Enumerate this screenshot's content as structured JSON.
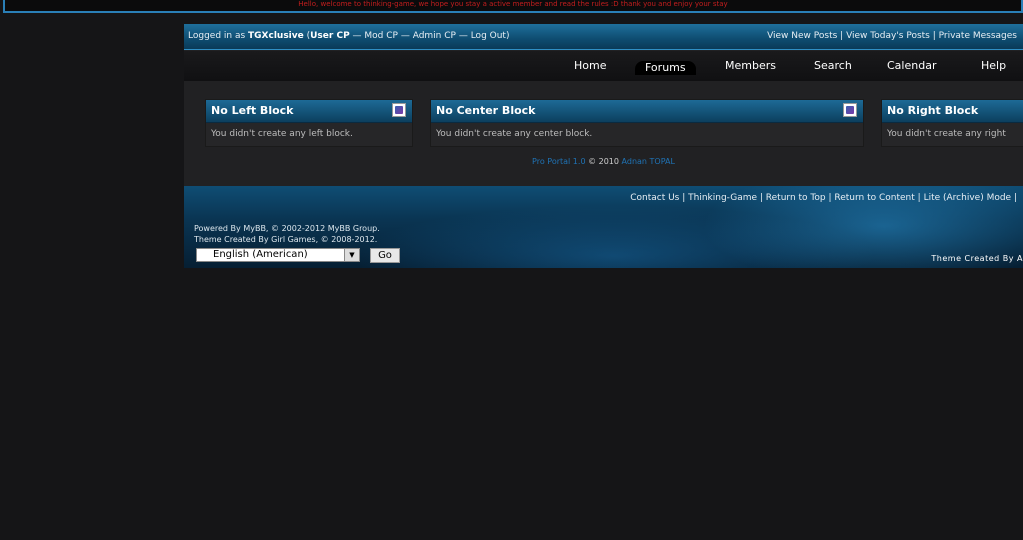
{
  "welcome": "Hello, welcome to thinking-game, we hope you stay a active member and read the rules :D thank you and enjoy your stay",
  "userbar": {
    "logged_in_prefix": "Logged in as ",
    "username": "TGXclusive",
    "open_paren": " (",
    "user_cp": "User CP",
    "sep1": " — ",
    "mod_cp": "Mod CP",
    "sep2": " — ",
    "admin_cp": "Admin CP",
    "sep3": " — ",
    "log_out": "Log Out",
    "close_paren": ")",
    "view_new_posts": "View New Posts",
    "pipe1": " | ",
    "view_todays_posts": "View Today's Posts",
    "pipe2": " | ",
    "private_messages": "Private Messages"
  },
  "nav": {
    "home": "Home",
    "forums": "Forums",
    "members": "Members",
    "search": "Search",
    "calendar": "Calendar",
    "help": "Help"
  },
  "blocks": {
    "left": {
      "title": "No Left Block",
      "body": "You didn't create any left block."
    },
    "center": {
      "title": "No Center Block",
      "body": "You didn't create any center block."
    },
    "right": {
      "title": "No Right Block",
      "body": "You didn't create any right"
    }
  },
  "credit": {
    "portal": "Pro Portal 1.0",
    "copyright": " © 2010 ",
    "author": "Adnan TOPAL"
  },
  "footer": {
    "contact_us": "Contact Us",
    "pipe1": " | ",
    "thinking_game": "Thinking-Game",
    "pipe2": " | ",
    "return_top": "Return to Top",
    "pipe3": " | ",
    "return_content": "Return to Content",
    "pipe4": " | ",
    "lite_mode": "Lite (Archive) Mode",
    "pipe5": " |",
    "powered_by": "Powered By MyBB, © 2002-2012 MyBB Group.",
    "theme_credit": "Theme Created By Girl Games, © 2008-2012.",
    "language_value": "English (American)",
    "go_label": "Go",
    "theme_created_by": "Theme Created By A"
  }
}
